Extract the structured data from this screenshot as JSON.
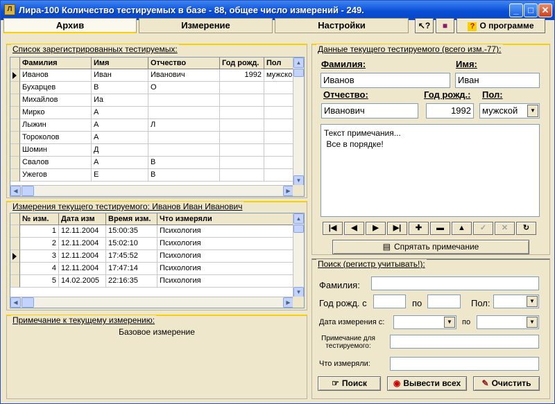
{
  "window": {
    "title": "Лира-100   Количество тестируемых в базе - 88, общее число измерений - 249."
  },
  "tabs": [
    "Архив",
    "Измерение",
    "Настройки"
  ],
  "toolbar": {
    "about": "О программе"
  },
  "subjects": {
    "title": "Список зарегистрированных тестируемых:",
    "columns": [
      "Фамилия",
      "Имя",
      "Отчество",
      "Год рожд.",
      "Пол"
    ],
    "rows": [
      [
        "Иванов",
        "Иван",
        "Иванович",
        "1992",
        "мужско"
      ],
      [
        "Бухарцев",
        "В",
        "О",
        "",
        ""
      ],
      [
        "Михайлов",
        "Иа",
        "",
        "",
        ""
      ],
      [
        "Мирко",
        "А",
        "",
        "",
        ""
      ],
      [
        "Лыжин",
        "А",
        "Л",
        "",
        ""
      ],
      [
        "Тороколов",
        "А",
        "",
        "",
        ""
      ],
      [
        "Шомин",
        "Д",
        "",
        "",
        ""
      ],
      [
        "Свалов",
        "А",
        "В",
        "",
        ""
      ],
      [
        "Ужегов",
        "Е",
        "В",
        "",
        ""
      ]
    ]
  },
  "measurements": {
    "title": "Измерения текущего тестируемого: Иванов Иван Иванович",
    "columns": [
      "№ изм.",
      "Дата изм",
      "Время изм.",
      "Что измеряли"
    ],
    "rows": [
      [
        "1",
        "12.11.2004",
        "15:00:35",
        "Психология"
      ],
      [
        "2",
        "12.11.2004",
        "15:02:10",
        "Психология"
      ],
      [
        "3",
        "12.11.2004",
        "17:45:52",
        "Психология"
      ],
      [
        "4",
        "12.11.2004",
        "17:47:14",
        "Психология"
      ],
      [
        "5",
        "14.02.2005",
        "22:16:35",
        "Психология"
      ]
    ]
  },
  "note": {
    "title": "Примечание к текущему измерению:",
    "text": "Базовое измерение"
  },
  "current": {
    "title": "Данные текущего тестируемого  (всего изм.-77):",
    "surname_label": "Фамилия:",
    "surname": "Иванов",
    "name_label": "Имя:",
    "name": "Иван",
    "patronymic_label": "Отчество:",
    "patronymic": "Иванович",
    "year_label": "Год рожд.:",
    "year": "1992",
    "sex_label": "Пол:",
    "sex": "мужской",
    "note_line1": "Текст примечания...",
    "note_line2": " Все в порядке!",
    "hide_note": "Спрятать примечание"
  },
  "search": {
    "title": "Поиск (регистр учитывать!):",
    "surname_label": "Фамилия:",
    "year_from_label": "Год рожд. с",
    "to_label": "по",
    "sex_label": "Пол:",
    "date_from_label": "Дата измерения с:",
    "date_to_label": "по",
    "note_label_1": "Примечание для",
    "note_label_2": "тестируемого:",
    "what_label": "Что измеряли:",
    "search_btn": "Поиск",
    "show_all_btn": "Вывести всех",
    "clear_btn": "Очистить"
  }
}
